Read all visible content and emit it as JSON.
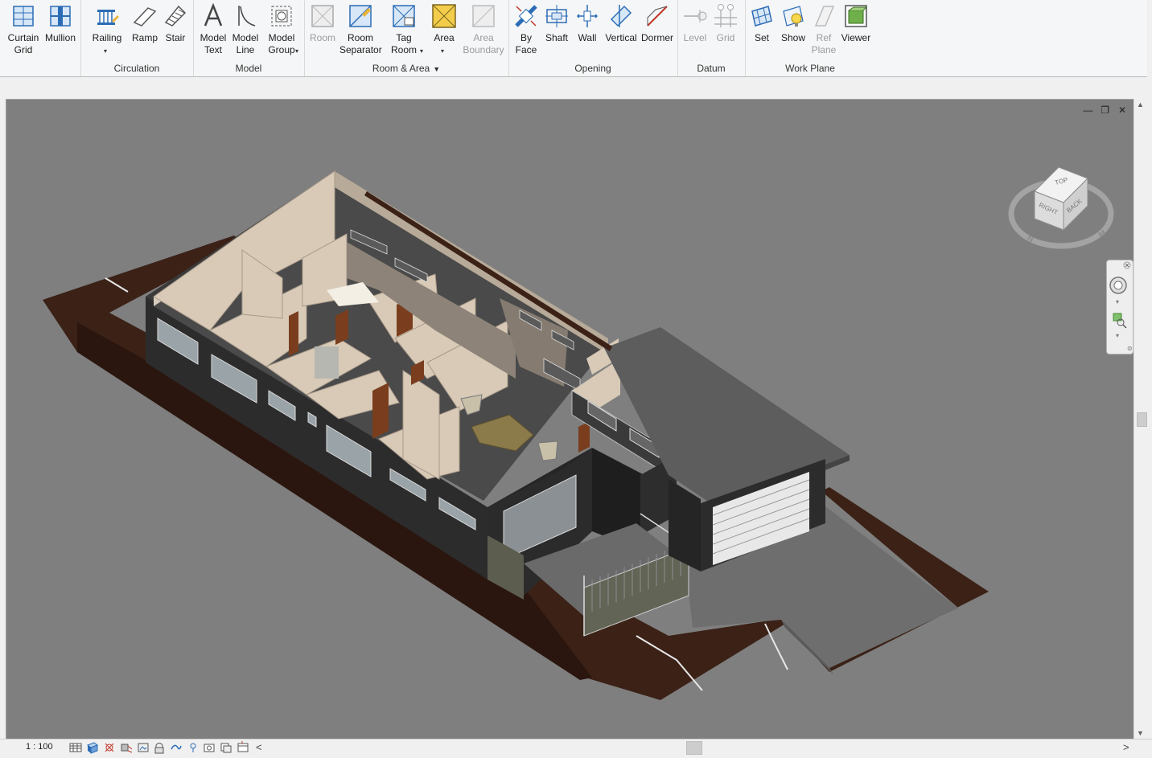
{
  "ribbon": {
    "panels": [
      {
        "label": "Circulation"
      },
      {
        "label": "Model"
      },
      {
        "label": "Room & Area"
      },
      {
        "label": "Opening"
      },
      {
        "label": "Datum"
      },
      {
        "label": "Work Plane"
      }
    ],
    "tools": {
      "curtain_grid": [
        "Curtain",
        "Grid"
      ],
      "mullion": "Mullion",
      "railing": "Railing",
      "ramp": "Ramp",
      "stair": "Stair",
      "model_text": [
        "Model",
        "Text"
      ],
      "model_line": [
        "Model",
        "Line"
      ],
      "model_group": [
        "Model",
        "Group"
      ],
      "room": "Room",
      "room_separator": [
        "Room",
        "Separator"
      ],
      "tag_room": [
        "Tag",
        "Room"
      ],
      "area": "Area",
      "area_boundary": [
        "Area",
        "Boundary"
      ],
      "by_face": [
        "By",
        "Face"
      ],
      "shaft": "Shaft",
      "wall": "Wall",
      "vertical": "Vertical",
      "dormer": "Dormer",
      "level": "Level",
      "grid": "Grid",
      "set": "Set",
      "show": "Show",
      "ref_plane": [
        "Ref",
        "Plane"
      ],
      "viewer": "Viewer"
    }
  },
  "view_controls": {
    "minimize": "—",
    "restore": "❐",
    "close": "✕"
  },
  "viewcube": {
    "top": "TOP",
    "right": "RIGHT",
    "back": "BACK",
    "compass_n": "N"
  },
  "statusbar": {
    "scale": "1 : 100"
  },
  "colors": {
    "accent": "#1e6fb8",
    "viewport_bg": "#7f7f7f",
    "ribbon_bg": "#f5f6f7"
  }
}
